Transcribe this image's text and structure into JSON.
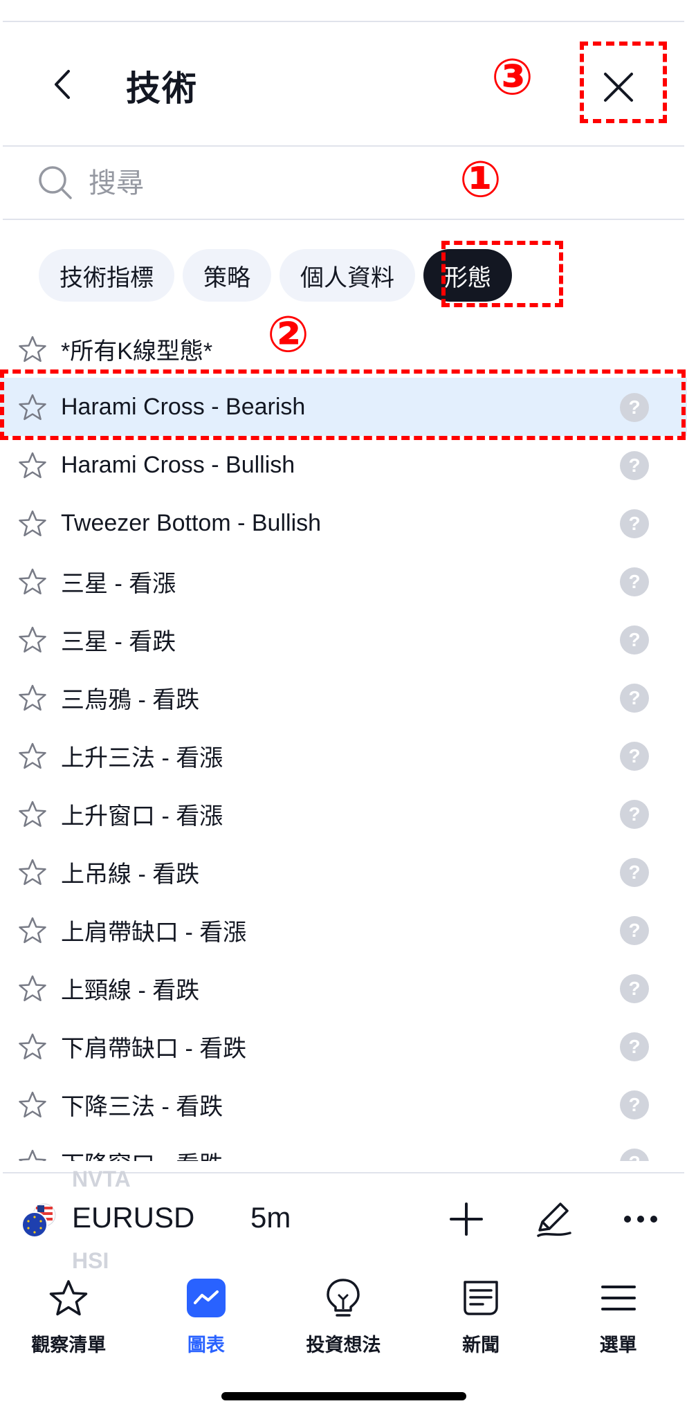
{
  "header": {
    "title": "技術",
    "back_icon": "chevron-left-icon",
    "close_icon": "close-icon"
  },
  "search": {
    "placeholder": "搜尋",
    "value": ""
  },
  "tabs": [
    {
      "label": "技術指標",
      "active": false
    },
    {
      "label": "策略",
      "active": false
    },
    {
      "label": "個人資料",
      "active": false
    },
    {
      "label": "形態",
      "active": true
    }
  ],
  "list": {
    "items": [
      {
        "label": "*所有K線型態*",
        "help": false,
        "selected": false
      },
      {
        "label": "Harami Cross - Bearish",
        "help": true,
        "selected": true
      },
      {
        "label": "Harami Cross - Bullish",
        "help": true,
        "selected": false
      },
      {
        "label": "Tweezer Bottom - Bullish",
        "help": true,
        "selected": false
      },
      {
        "label": "三星 - 看漲",
        "help": true,
        "selected": false
      },
      {
        "label": "三星 - 看跌",
        "help": true,
        "selected": false
      },
      {
        "label": "三烏鴉 - 看跌",
        "help": true,
        "selected": false
      },
      {
        "label": "上升三法 - 看漲",
        "help": true,
        "selected": false
      },
      {
        "label": "上升窗口 - 看漲",
        "help": true,
        "selected": false
      },
      {
        "label": "上吊線 - 看跌",
        "help": true,
        "selected": false
      },
      {
        "label": "上肩帶缺口 - 看漲",
        "help": true,
        "selected": false
      },
      {
        "label": "上頸線 - 看跌",
        "help": true,
        "selected": false
      },
      {
        "label": "下肩帶缺口 - 看跌",
        "help": true,
        "selected": false
      },
      {
        "label": "下降三法 - 看跌",
        "help": true,
        "selected": false
      },
      {
        "label": "下降窗口 - 看跌",
        "help": true,
        "selected": false
      }
    ],
    "help_glyph": "?"
  },
  "toolbar": {
    "ghost_above": "NVTA",
    "ghost_below": "HSI",
    "symbol": "EURUSD",
    "interval": "5m",
    "flag_icon": "eu-us-flag-icon",
    "add_icon": "plus-icon",
    "draw_icon": "pen-icon",
    "more_icon": "more-horizontal-icon"
  },
  "bottom_nav": [
    {
      "label": "觀察清單",
      "icon": "star-icon",
      "active": false
    },
    {
      "label": "圖表",
      "icon": "chart-icon",
      "active": true
    },
    {
      "label": "投資想法",
      "icon": "lightbulb-icon",
      "active": false
    },
    {
      "label": "新聞",
      "icon": "news-icon",
      "active": false
    },
    {
      "label": "選單",
      "icon": "menu-icon",
      "active": false
    }
  ],
  "annotations": {
    "one": "①",
    "two": "②",
    "three": "③"
  },
  "colors": {
    "accent": "#2962ff",
    "annotation": "#ff0000",
    "selected_row": "#e3effd",
    "active_tab": "#131722"
  }
}
